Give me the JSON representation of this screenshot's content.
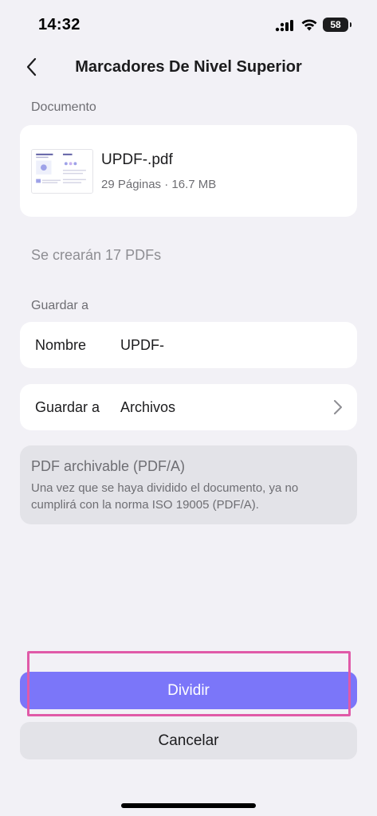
{
  "status_bar": {
    "time": "14:32",
    "battery": "58"
  },
  "nav": {
    "title": "Marcadores De Nivel Superior"
  },
  "document_section": {
    "label": "Documento",
    "file_name": "UPDF-.pdf",
    "file_meta": "29 Páginas · 16.7 MB"
  },
  "info": {
    "text": "Se crearán 17 PDFs"
  },
  "save_section": {
    "label": "Guardar a",
    "name_row": {
      "label": "Nombre",
      "value": "UPDF-"
    },
    "location_row": {
      "label": "Guardar a",
      "value": "Archivos"
    }
  },
  "archive": {
    "title": "PDF archivable (PDF/A)",
    "description": "Una vez que se haya dividido el documento, ya no cumplirá con la norma ISO 19005 (PDF/A)."
  },
  "buttons": {
    "primary": "Dividir",
    "secondary": "Cancelar"
  },
  "colors": {
    "accent": "#7b76f9",
    "highlight": "#e05aa8",
    "background": "#f2f1f6"
  }
}
